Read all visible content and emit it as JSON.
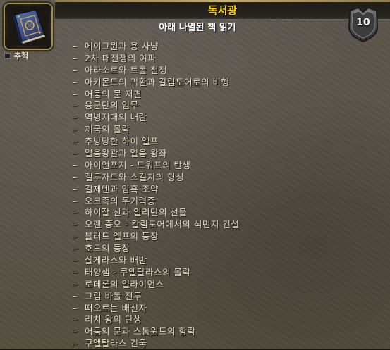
{
  "window": {
    "title": "독서광",
    "subtitle": "아래 나열된 책 읽기",
    "points": "10",
    "track_label": "추적"
  },
  "icons": {
    "achievement_icon": "book-icon",
    "points_badge": "shield-badge-icon",
    "track_checkbox": "checkbox-icon"
  },
  "colors": {
    "title": "#ffd100",
    "list_text": "#e6dfc8",
    "frame_gold": "#a08a4d"
  },
  "criteria": [
    "에이그윈과 용 사냥",
    "2차 대전쟁의 여파",
    "아라소르와 트롤 전쟁",
    "아키몬드의 귀환과 칼림도어로의 비행",
    "어둠의 문 저편",
    "용군단의 임무",
    "역병지대의 내란",
    "제국의 몰락",
    "추방당한 하이 엘프",
    "얼음왕관과 얼음 왕좌",
    "아이언포지 - 드워프의 탄생",
    "켈투자드와 스컬지의 형성",
    "킬제덴과 암흑 조약",
    "오크족의 무기력증",
    "하이잘 산과 일리단의 선물",
    "오랜 증오 - 칼림도어에서의 식민지 건설",
    "블러드 엘프의 등장",
    "호드의 등장",
    "살게라스와 배반",
    "태양샘 - 쿠엘탈라스의 몰락",
    "로데론의 얼라이언스",
    "그림 바톨 전투",
    "떠오르는 배신자",
    "리치 왕의 탄생",
    "어둠의 문과 스톰윈드의 함락",
    "쿠엘탈라스 건국"
  ]
}
